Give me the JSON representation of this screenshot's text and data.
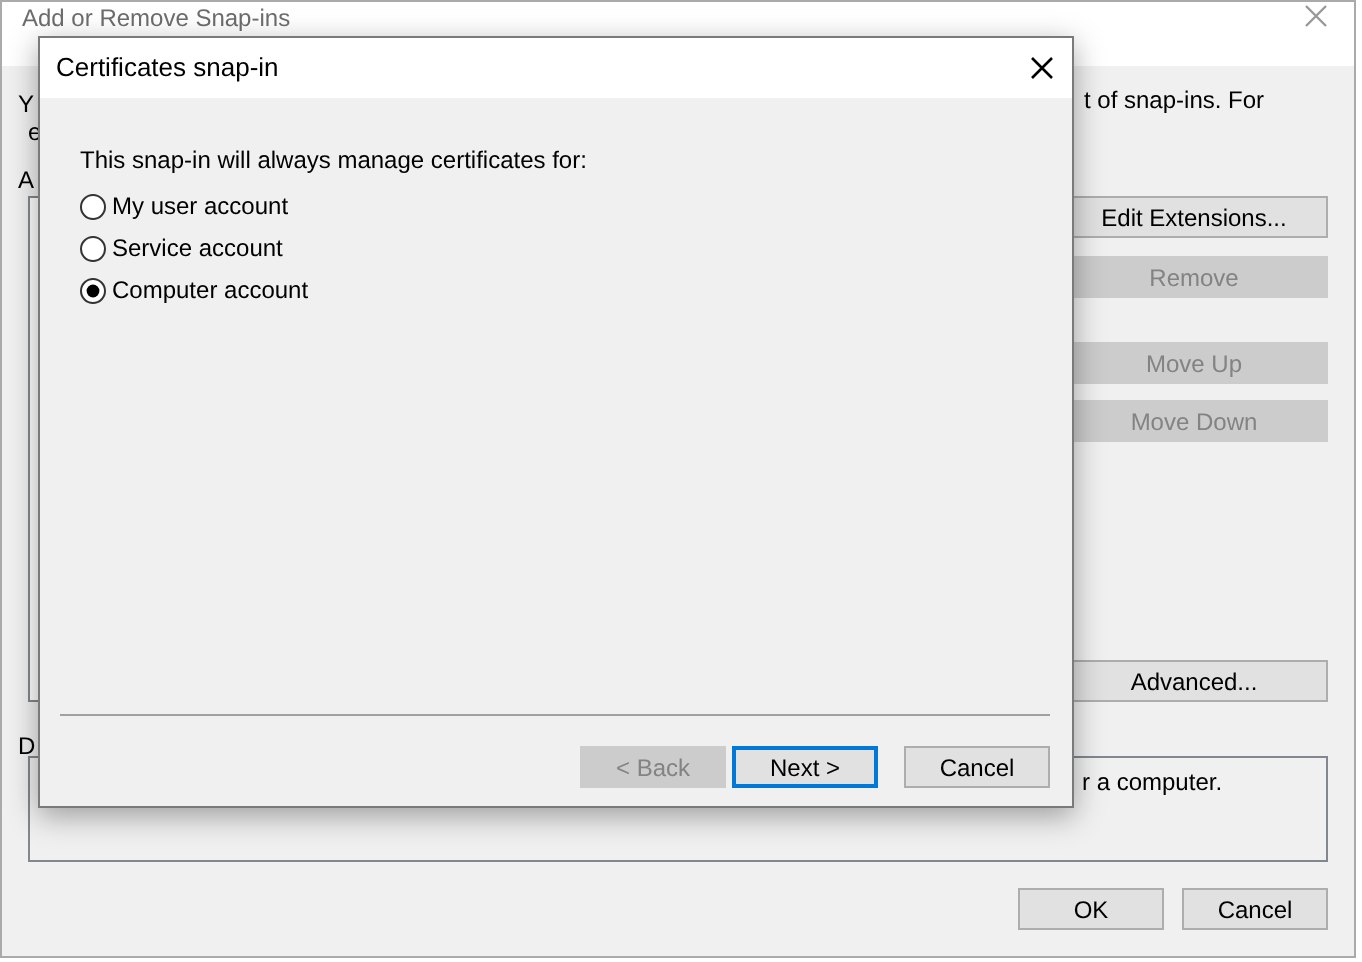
{
  "background_window": {
    "title": "Add or Remove Snap-ins",
    "intro_left": [
      "Y",
      "e"
    ],
    "intro_right": "t of snap-ins. For",
    "list_label": "A",
    "side_buttons": [
      {
        "label": "Edit Extensions...",
        "disabled": false
      },
      {
        "label": "Remove",
        "disabled": true
      },
      {
        "label": "Move Up",
        "disabled": true
      },
      {
        "label": "Move Down",
        "disabled": true
      },
      {
        "label": "Advanced...",
        "disabled": false
      }
    ],
    "description_label": "D",
    "description_text": "r a computer.",
    "footer_buttons": [
      "OK",
      "Cancel"
    ]
  },
  "dialog": {
    "title": "Certificates snap-in",
    "prompt": "This snap-in will always manage certificates for:",
    "options": [
      {
        "label": "My user account",
        "selected": false
      },
      {
        "label": "Service account",
        "selected": false
      },
      {
        "label": "Computer account",
        "selected": true
      }
    ],
    "buttons": [
      {
        "label": "< Back",
        "disabled": true,
        "default": false
      },
      {
        "label": "Next >",
        "disabled": false,
        "default": true
      },
      {
        "label": "Cancel",
        "disabled": false,
        "default": false
      }
    ]
  }
}
